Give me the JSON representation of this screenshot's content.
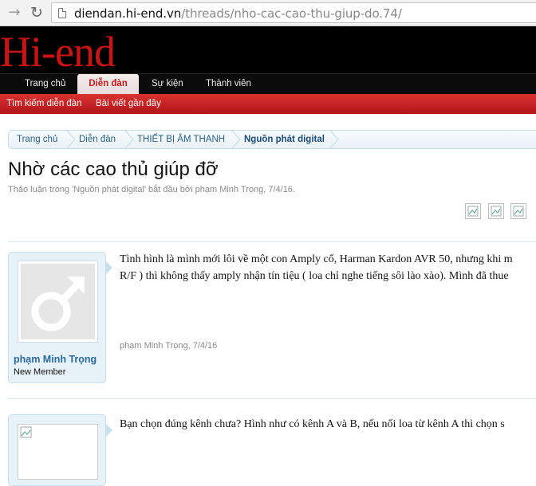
{
  "browser": {
    "url_host": "diendan.hi-end.vn",
    "url_path": "/threads/nho-cac-cao-thu-giup-do.74/"
  },
  "site": {
    "logo": "Hi-end",
    "tabs": [
      "Trang chủ",
      "Diễn đàn",
      "Sự kiện",
      "Thành viên"
    ],
    "active_tab": "Diễn đàn",
    "sub_links": [
      "Tìm kiếm diễn đàn",
      "Bài viết gần đây"
    ]
  },
  "breadcrumb": [
    "Trang chủ",
    "Diễn đàn",
    "THIẾT BỊ ÂM THANH",
    "Nguồn phát digital"
  ],
  "thread": {
    "title": "Nhờ các cao thủ giúp đỡ",
    "meta": "Thảo luận trong 'Nguồn phát digital' bắt đầu bởi phạm Minh Trọng, 7/4/16."
  },
  "share_icons": [
    "share-icon",
    "share-icon",
    "share-icon"
  ],
  "posts": [
    {
      "username": "phạm Minh Trọng",
      "user_title": "New Member",
      "lines": [
        "Tình hình là mình mới lôi về một con Amply cổ, Harman Kardon AVR 50, nhưng khi m",
        "R/F ) thì không thấy amply nhận tín tiệu ( loa chỉ nghe tiếng sôi lào xào). Mình đã thue"
      ],
      "footer": "phạm Minh Trọng, 7/4/16"
    },
    {
      "username": "",
      "user_title": "",
      "lines": [
        "Bạn chọn đúng kênh chưa? Hình như có kênh A và B, nếu nối loa từ kênh A thì chọn s"
      ],
      "footer": ""
    }
  ],
  "colors": {
    "brand_red": "#c81414",
    "nav_black": "#0b0b0b",
    "link_blue": "#2a6a9c"
  }
}
